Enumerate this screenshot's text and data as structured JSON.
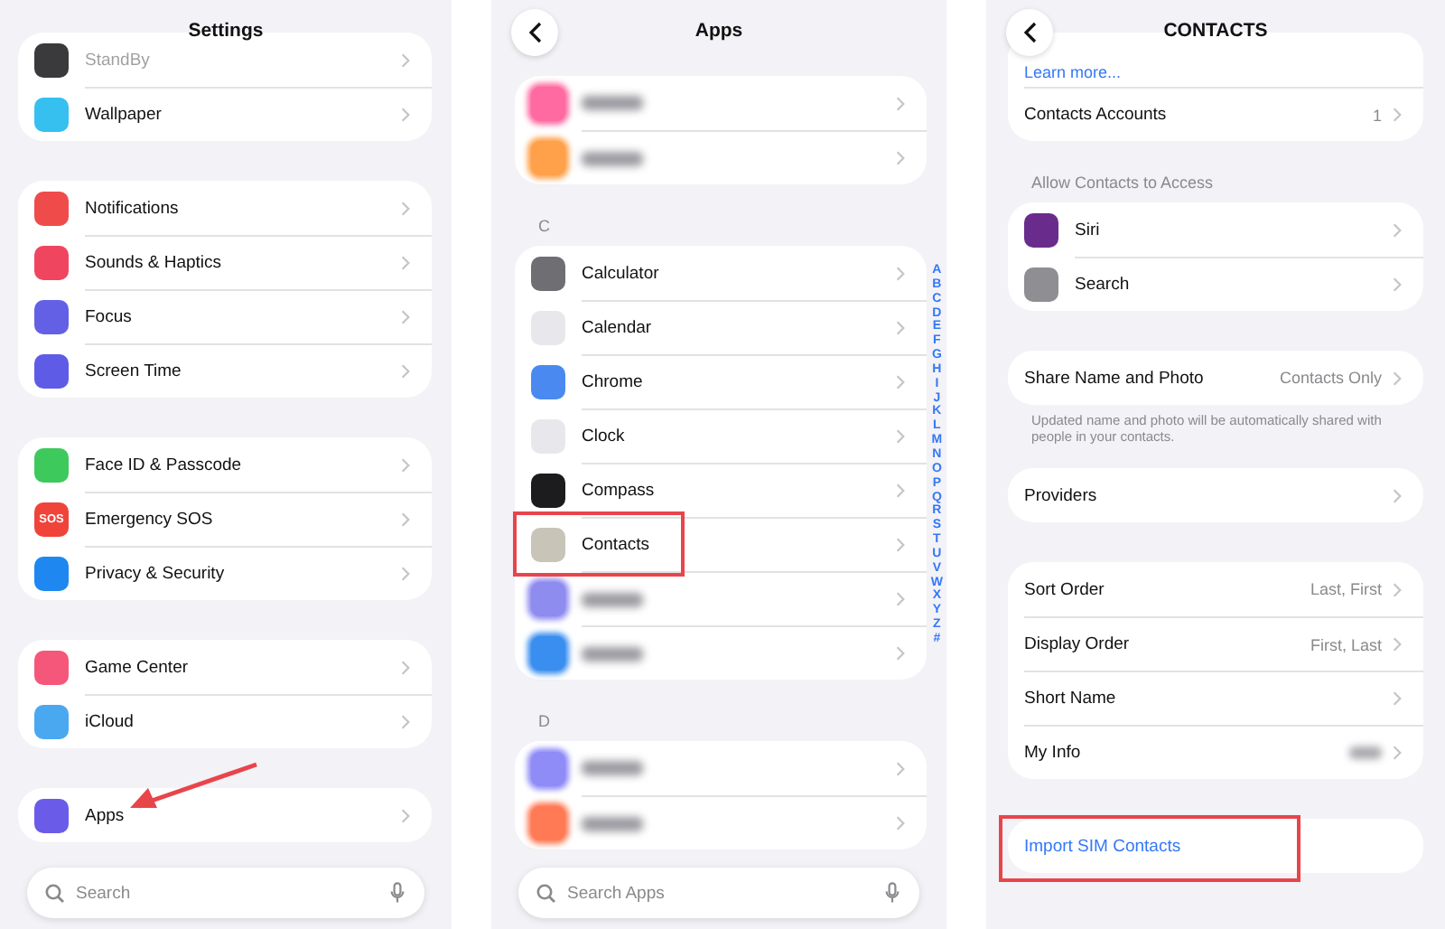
{
  "panels": [
    {
      "title": "Settings",
      "back_button": false,
      "sections": [
        {
          "rows": [
            {
              "kind": "nav",
              "label": "StandBy",
              "color": "#3a3a3c",
              "faded": true
            },
            {
              "kind": "nav",
              "label": "Wallpaper",
              "color": "#35c0f0"
            }
          ]
        },
        {
          "rows": [
            {
              "kind": "nav",
              "label": "Notifications",
              "color": "#f04b4b"
            },
            {
              "kind": "nav",
              "label": "Sounds & Haptics",
              "color": "#f0455f"
            },
            {
              "kind": "nav",
              "label": "Focus",
              "color": "#6360e6"
            },
            {
              "kind": "nav",
              "label": "Screen Time",
              "color": "#5e5ce6"
            }
          ]
        },
        {
          "rows": [
            {
              "kind": "nav",
              "label": "Face ID & Passcode",
              "color": "#3ec95c"
            },
            {
              "kind": "nav",
              "label": "Emergency SOS",
              "color": "#f0433a",
              "icon_text": "SOS"
            },
            {
              "kind": "nav",
              "label": "Privacy & Security",
              "color": "#1e88f0"
            }
          ]
        },
        {
          "rows": [
            {
              "kind": "nav",
              "label": "Game Center",
              "color": "#f5577a"
            },
            {
              "kind": "nav",
              "label": "iCloud",
              "color": "#4aa8f0"
            }
          ]
        },
        {
          "rows": [
            {
              "kind": "nav",
              "label": "Apps",
              "color": "#6a5ce8",
              "pointed": true
            }
          ]
        }
      ],
      "search": {
        "placeholder": "Search"
      }
    },
    {
      "title": "Apps",
      "back_button": true,
      "sections": [
        {
          "rows": [
            {
              "kind": "blurred",
              "color": "#ff6aa0"
            },
            {
              "kind": "blurred",
              "color": "#ffa04a"
            }
          ]
        },
        {
          "header": "C",
          "rows": [
            {
              "kind": "nav",
              "label": "Calculator",
              "color": "#6e6e73"
            },
            {
              "kind": "nav",
              "label": "Calendar",
              "color": "#e8e8ec"
            },
            {
              "kind": "nav",
              "label": "Chrome",
              "color": "#4a8af0"
            },
            {
              "kind": "nav",
              "label": "Clock",
              "color": "#e8e8ec"
            },
            {
              "kind": "nav",
              "label": "Compass",
              "color": "#1c1c1e"
            },
            {
              "kind": "nav",
              "label": "Contacts",
              "color": "#c8c4b8",
              "highlighted": true
            },
            {
              "kind": "blurred",
              "color": "#8f8cf0"
            },
            {
              "kind": "blurred",
              "color": "#3a8ef0"
            }
          ]
        },
        {
          "header": "D",
          "rows": [
            {
              "kind": "blurred",
              "color": "#8f8cf8"
            },
            {
              "kind": "blurred",
              "color": "#ff7a55"
            }
          ]
        }
      ],
      "index_letters": [
        "A",
        "B",
        "C",
        "D",
        "E",
        "F",
        "G",
        "H",
        "I",
        "J",
        "K",
        "L",
        "M",
        "N",
        "O",
        "P",
        "Q",
        "R",
        "S",
        "T",
        "U",
        "V",
        "W",
        "X",
        "Y",
        "Z",
        "#"
      ],
      "search": {
        "placeholder": "Search Apps"
      }
    },
    {
      "title": "CONTACTS",
      "back_button": true,
      "sections": [
        {
          "rows": [
            {
              "kind": "link",
              "label": "Learn more..."
            },
            {
              "kind": "nav",
              "label": "Contacts Accounts",
              "value": "1"
            }
          ]
        },
        {
          "header": "Allow Contacts to Access",
          "rows": [
            {
              "kind": "nav",
              "label": "Siri",
              "color": "#6a2c8c"
            },
            {
              "kind": "nav",
              "label": "Search",
              "color": "#8e8e93"
            }
          ]
        },
        {
          "rows": [
            {
              "kind": "nav",
              "label": "Share Name and Photo",
              "value": "Contacts Only"
            }
          ],
          "footer": "Updated name and photo will be automatically shared with people in your contacts."
        },
        {
          "rows": [
            {
              "kind": "nav",
              "label": "Providers"
            }
          ]
        },
        {
          "rows": [
            {
              "kind": "nav",
              "label": "Sort Order",
              "value": "Last, First"
            },
            {
              "kind": "nav",
              "label": "Display Order",
              "value": "First, Last"
            },
            {
              "kind": "nav",
              "label": "Short Name"
            },
            {
              "kind": "nav",
              "label": "My Info",
              "value_blurred": true
            }
          ]
        },
        {
          "rows": [
            {
              "kind": "button",
              "label": "Import SIM Contacts",
              "highlighted": true
            }
          ]
        }
      ]
    }
  ]
}
